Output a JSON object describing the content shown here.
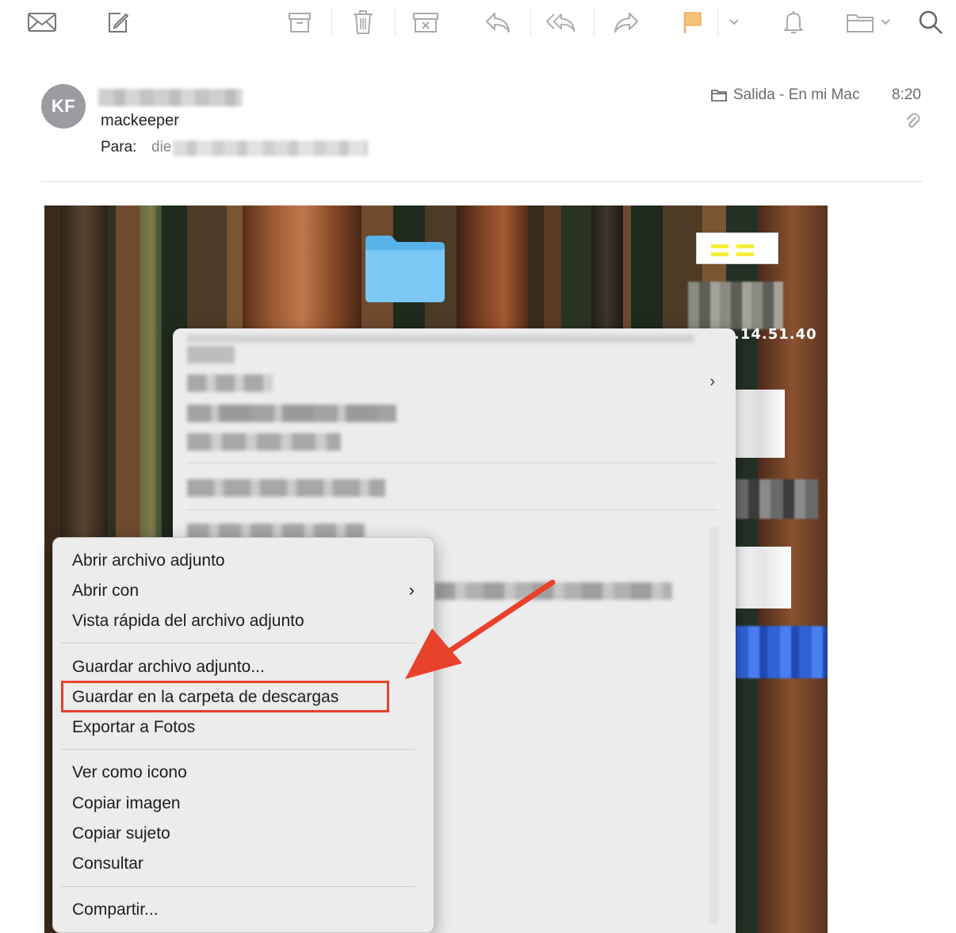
{
  "toolbar": {
    "items": [
      "mail-icon",
      "compose-icon",
      "archive-icon",
      "trash-icon",
      "junk-icon",
      "reply-icon",
      "reply-all-icon",
      "forward-icon",
      "flag-icon",
      "flag-menu-chevron-icon",
      "bell-icon",
      "move-folder-icon",
      "search-icon"
    ]
  },
  "message": {
    "avatar_initials": "KF",
    "subject": "mackeeper",
    "to_label": "Para:",
    "to_prefix": "die",
    "mailbox": "Salida - En mi Mac",
    "time": "8:20"
  },
  "screenshot": {
    "overlay_text": ".14.51.40"
  },
  "context_menu": {
    "items": [
      {
        "label": "Abrir archivo adjunto"
      },
      {
        "label": "Abrir con",
        "submenu": true
      },
      {
        "label": "Vista rápida del archivo adjunto"
      },
      {
        "label": "Guardar archivo adjunto..."
      },
      {
        "label": "Guardar en la carpeta de descargas",
        "highlighted": true
      },
      {
        "label": "Exportar a Fotos"
      },
      {
        "label": "Ver como icono"
      },
      {
        "label": "Copiar imagen"
      },
      {
        "label": "Copiar sujeto"
      },
      {
        "label": "Consultar"
      },
      {
        "label": "Compartir..."
      }
    ]
  },
  "colors": {
    "annotation_red": "#e8412c",
    "flag_orange": "#f6c27a",
    "avatar_gray": "#9b9ba0"
  }
}
